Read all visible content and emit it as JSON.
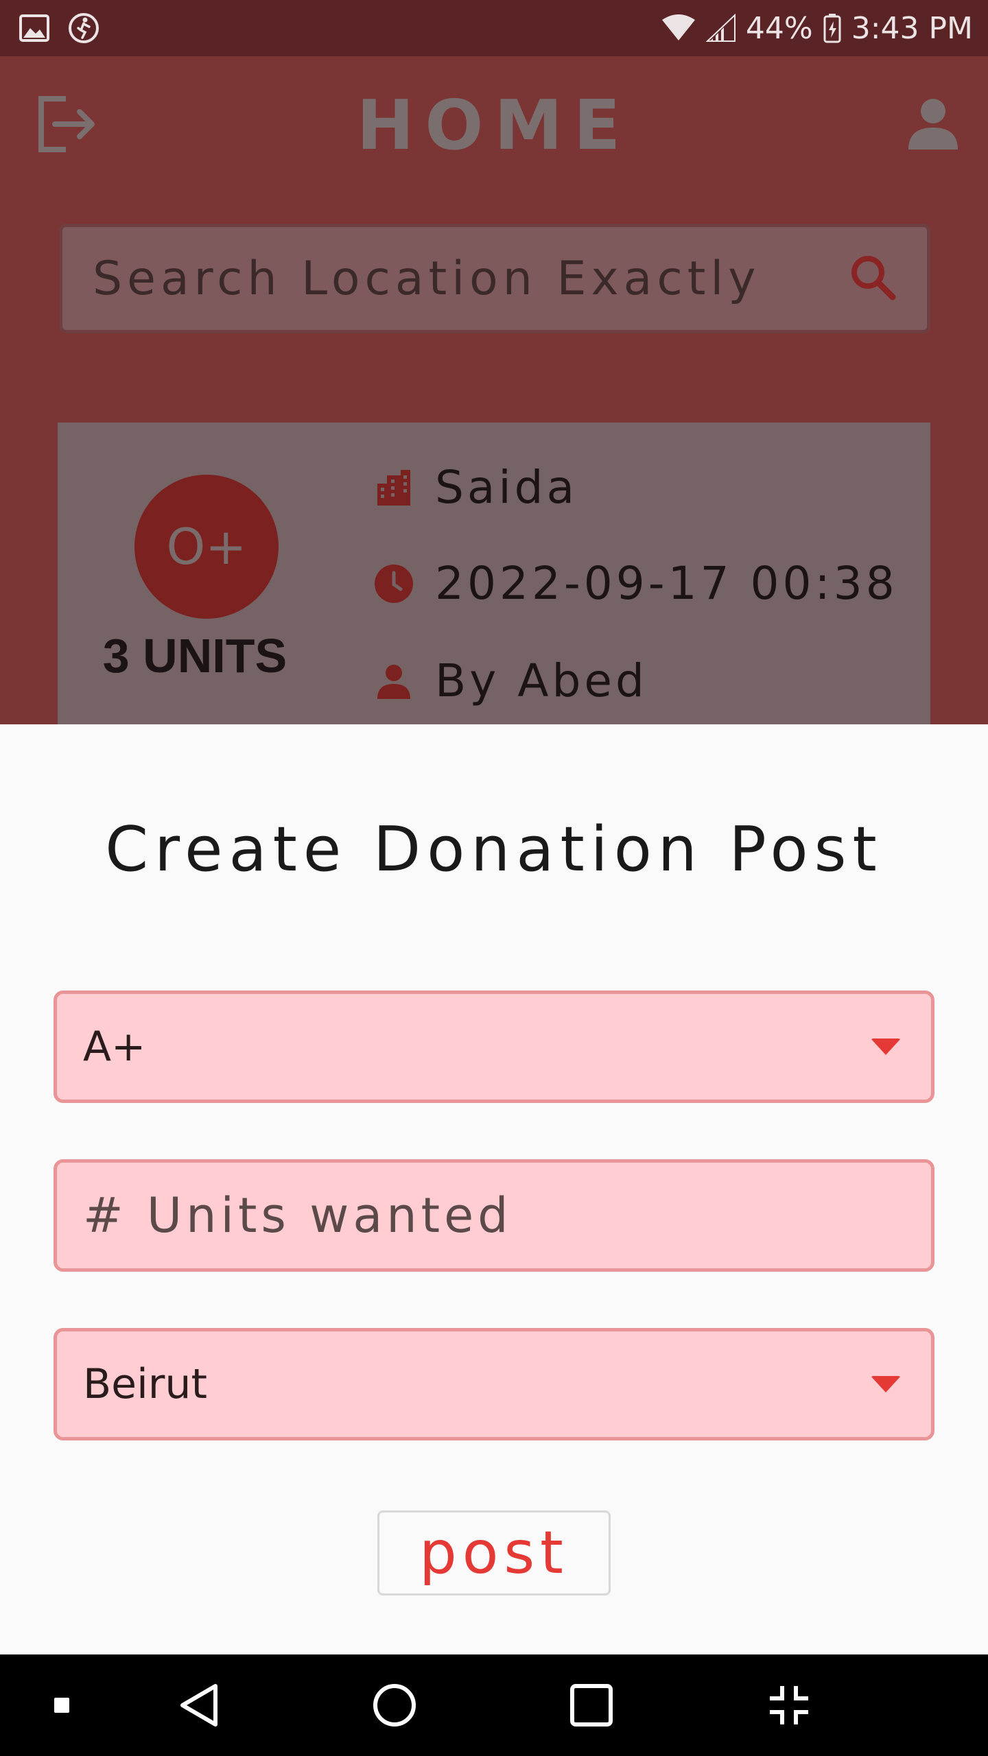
{
  "status_bar": {
    "battery": "44%",
    "time": "3:43 PM",
    "icons": [
      "image-icon",
      "activity-icon",
      "wifi-icon",
      "signal-icon",
      "battery-charging-icon"
    ]
  },
  "app_bar": {
    "title": "HOME",
    "left_icon": "logout-icon",
    "right_icon": "profile-icon"
  },
  "search": {
    "placeholder": "Search Location Exactly",
    "icon": "search-icon"
  },
  "card": {
    "blood_type": "O+",
    "units": "3 UNITS",
    "location": "Saida",
    "datetime": "2022-09-17 00:38",
    "author": "By Abed"
  },
  "sheet": {
    "title": "Create Donation Post",
    "blood_type_value": "A+",
    "units_placeholder": "# Units wanted",
    "location_value": "Beirut",
    "post_label": "post"
  },
  "colors": {
    "accent": "#e53935",
    "field_bg": "#ffcdd2",
    "field_border": "#e99496",
    "overlay_bg": "#7b3535"
  }
}
